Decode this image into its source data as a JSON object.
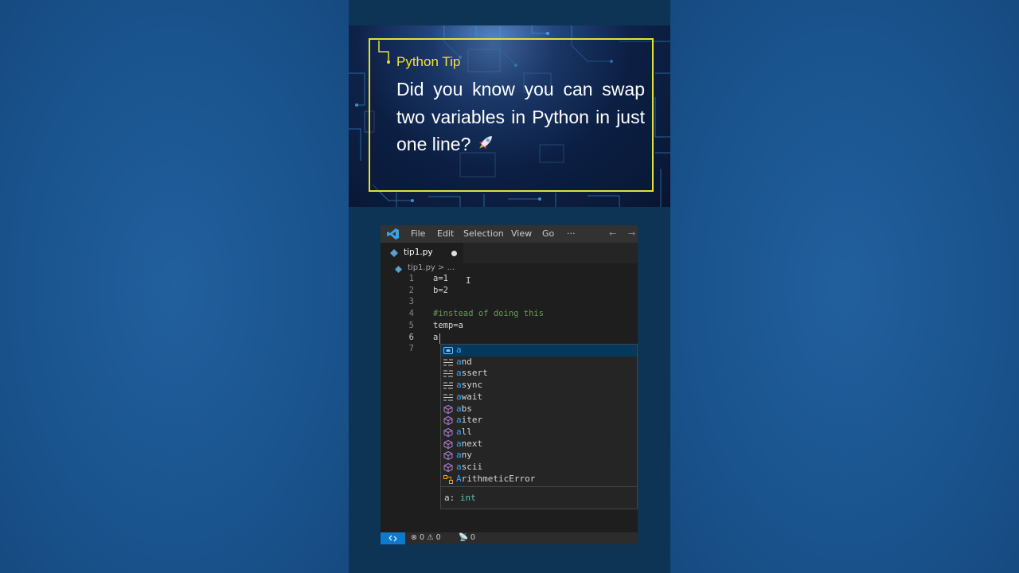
{
  "banner": {
    "label": "Python Tip",
    "text": "Did you know you can swap two variables in Python in just one line?",
    "emoji": "🚀"
  },
  "menu": {
    "items": [
      "File",
      "Edit",
      "Selection",
      "View",
      "Go",
      "···"
    ],
    "back": "←",
    "forward": "→"
  },
  "tab": {
    "filename": "tip1.py"
  },
  "breadcrumb": {
    "text": "tip1.py > ..."
  },
  "editor": {
    "lines": [
      {
        "num": "1",
        "code": "a=1"
      },
      {
        "num": "2",
        "code": "b=2"
      },
      {
        "num": "3",
        "code": ""
      },
      {
        "num": "4",
        "code": "#instead of doing this"
      },
      {
        "num": "5",
        "code": "temp=a"
      },
      {
        "num": "6",
        "code": "a"
      },
      {
        "num": "7",
        "code": ""
      }
    ],
    "ibeam": "I"
  },
  "suggest": {
    "items": [
      {
        "prefix": "a",
        "rest": "",
        "kind": "variable"
      },
      {
        "prefix": "a",
        "rest": "nd",
        "kind": "keyword"
      },
      {
        "prefix": "a",
        "rest": "ssert",
        "kind": "keyword"
      },
      {
        "prefix": "a",
        "rest": "sync",
        "kind": "keyword"
      },
      {
        "prefix": "a",
        "rest": "wait",
        "kind": "keyword"
      },
      {
        "prefix": "a",
        "rest": "bs",
        "kind": "function"
      },
      {
        "prefix": "a",
        "rest": "iter",
        "kind": "function"
      },
      {
        "prefix": "a",
        "rest": "ll",
        "kind": "function"
      },
      {
        "prefix": "a",
        "rest": "next",
        "kind": "function"
      },
      {
        "prefix": "a",
        "rest": "ny",
        "kind": "function"
      },
      {
        "prefix": "a",
        "rest": "scii",
        "kind": "function"
      },
      {
        "prefix": "A",
        "rest": "rithmeticError",
        "kind": "class"
      }
    ],
    "detail_name": "a:",
    "detail_type": "int"
  },
  "status": {
    "errors": "0",
    "warnings": "0",
    "ports": "0"
  },
  "colors": {
    "page_bg": "#1b5590",
    "tip_border": "#e8de3a",
    "tip_label": "#f2e33a",
    "match_highlight": "#2aaaff",
    "selected_row": "#04395e",
    "remote_button": "#0e7acc",
    "comment": "#6a9955",
    "type": "#4ec9b0"
  }
}
